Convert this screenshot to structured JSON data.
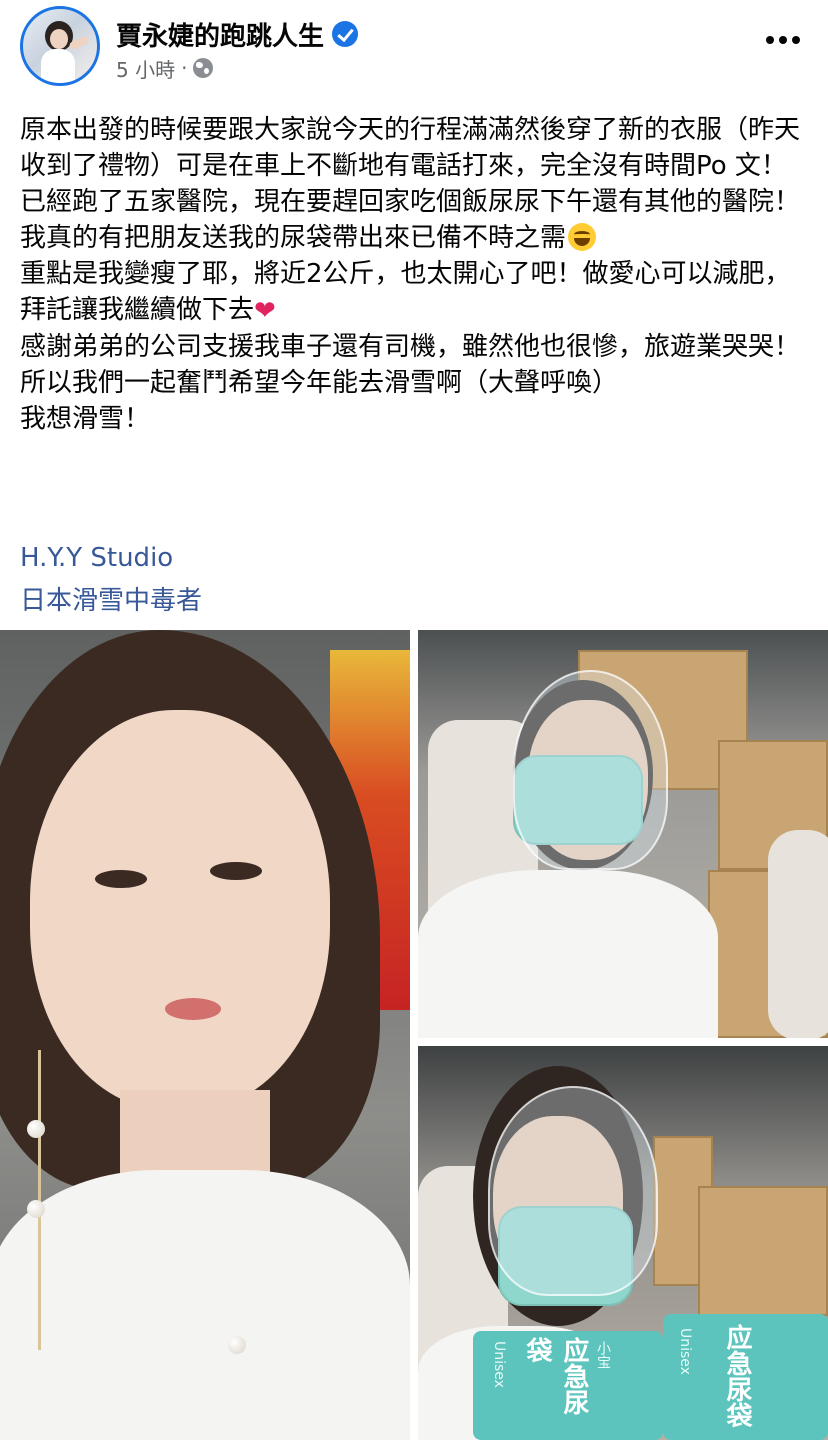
{
  "post": {
    "author": "賈永婕的跑跳人生",
    "time": "5 小時",
    "separator": "·",
    "audience_icon": "globe-icon",
    "verified_icon": "verified-badge-icon",
    "more_icon": "more-horizontal-icon"
  },
  "body": {
    "line1": "原本出發的時候要跟大家說今天的行程滿滿然後穿了新的衣服（昨天收到了禮物）可是在車上不斷地有電話打來，完全沒有時間Po 文！",
    "line2": "已經跑了五家醫院，現在要趕回家吃個飯尿尿下午還有其他的醫院！",
    "line3": "我真的有把朋友送我的尿袋帶出來已備不時之需",
    "line4": "重點是我變瘦了耶，將近2公斤，也太開心了吧！做愛心可以減肥，拜託讓我繼續做下去",
    "line5": "感謝弟弟的公司支援我車子還有司機，雖然他也很慘，旅遊業哭哭！",
    "line6": "所以我們一起奮鬥希望今年能去滑雪啊（大聲呼喚）",
    "line7": "我想滑雪！"
  },
  "links": {
    "tag1": "H.Y.Y Studio",
    "tag2": "日本滑雪中毒者"
  },
  "emoji": {
    "laugh": "laughing-emoji-icon",
    "heart": "❤"
  },
  "photo3": {
    "bag_label_1": "应急尿袋",
    "bag_label_2": "应急尿袋",
    "bag_brand": "Unisex",
    "bag_brand_2": "小宝"
  },
  "colors": {
    "link": "#385898",
    "meta": "#65676b",
    "verified": "#1b74e4",
    "text": "#050505"
  }
}
